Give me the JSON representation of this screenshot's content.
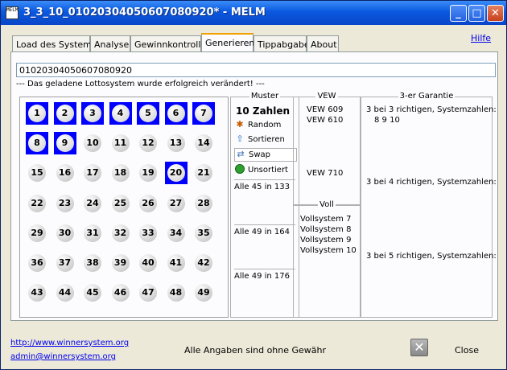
{
  "window": {
    "title": "3_3_10_01020304050607080920* - MELM",
    "icon_label": "MELM"
  },
  "titlebar_buttons": {
    "minimize": "_",
    "maximize": "□",
    "close": "✕"
  },
  "tabs": [
    {
      "label": "Load des Systems"
    },
    {
      "label": "Analyse"
    },
    {
      "label": "Gewinnkontrolle"
    },
    {
      "label": "Generieren"
    },
    {
      "label": "Tippabgabe"
    },
    {
      "label": "About"
    }
  ],
  "active_tab": "Generieren",
  "help_link": "Hilfe",
  "code_input_value": "01020304050607080920",
  "status_message": "--- Das geladene Lottosystem wurde erfolgreich verändert! ---",
  "numbers": [
    1,
    2,
    3,
    4,
    5,
    6,
    7,
    8,
    9,
    10,
    11,
    12,
    13,
    14,
    15,
    16,
    17,
    18,
    19,
    20,
    21,
    22,
    23,
    24,
    25,
    26,
    27,
    28,
    29,
    30,
    31,
    32,
    33,
    34,
    35,
    36,
    37,
    38,
    39,
    40,
    41,
    42,
    43,
    44,
    45,
    46,
    47,
    48,
    49
  ],
  "selected_numbers": [
    1,
    2,
    3,
    4,
    5,
    6,
    7,
    8,
    9,
    20
  ],
  "muster": {
    "title": "Muster",
    "count_label": "10  Zahlen",
    "tools": [
      {
        "label": "Random",
        "icon": "bug-icon"
      },
      {
        "label": "Sortieren",
        "icon": "arrow-up-icon"
      },
      {
        "label": "Swap",
        "icon": "swap-icon"
      },
      {
        "label": "Unsortiert",
        "icon": "green-circle-icon"
      }
    ],
    "stats": [
      "Alle 45 in 133",
      "Alle 49 in 164",
      "Alle 49 in 176"
    ]
  },
  "vew": {
    "title": "VEW",
    "items": [
      "VEW 609",
      "VEW 610",
      "VEW 710"
    ]
  },
  "voll": {
    "title": "Voll",
    "items": [
      "Vollsystem  7",
      "Vollsystem  8",
      "Vollsystem  9",
      "Vollsystem 10"
    ]
  },
  "garantie": {
    "title": "3-er Garantie",
    "line1": "3 bei 3 richtigen, Systemzahlen:",
    "line1_values": "8    9    10",
    "line2": "3 bei 4 richtigen, Systemzahlen:",
    "line3": "3 bei 5 richtigen, Systemzahlen:"
  },
  "footer": {
    "url": "http://www.winnersystem.org",
    "email": "admin@winnersystem.org",
    "disclaimer": "Alle Angaben sind ohne Gewähr",
    "close_label": "Close"
  }
}
